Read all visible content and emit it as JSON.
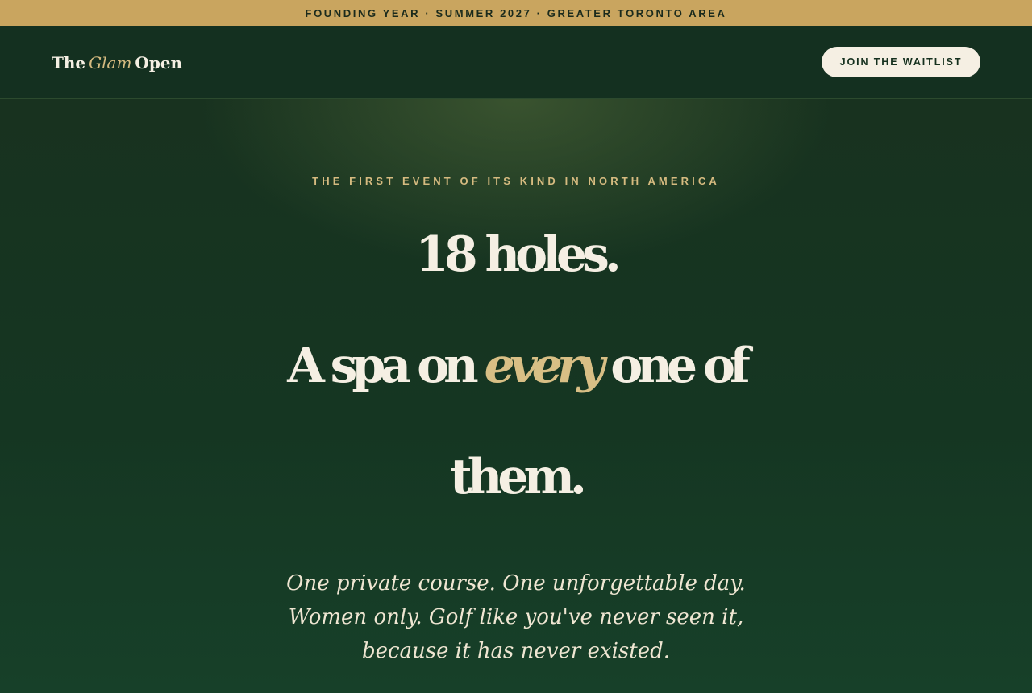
{
  "announcement": {
    "text": "FOUNDING YEAR · SUMMER 2027 · GREATER TORONTO AREA"
  },
  "header": {
    "logo_prefix": "The",
    "logo_accent": "Glam",
    "logo_suffix": "Open",
    "cta_label": "JOIN THE WAITLIST"
  },
  "hero": {
    "eyebrow": "THE FIRST EVENT OF ITS KIND IN NORTH AMERICA",
    "headline_line1": "18 holes.",
    "headline_line2_before": "A spa on ",
    "headline_line2_emphasis": "every",
    "headline_line2_after": " one of",
    "headline_line3": "them.",
    "subcopy_lines": [
      "One private course. One unforgettable day.",
      "Women only. Golf like you've never seen it,",
      "because it has never existed."
    ]
  },
  "colors": {
    "background_green": "#163420",
    "gold": "#c9a55f",
    "accent_gold": "#d6bb80",
    "cream": "#f5efe3"
  }
}
